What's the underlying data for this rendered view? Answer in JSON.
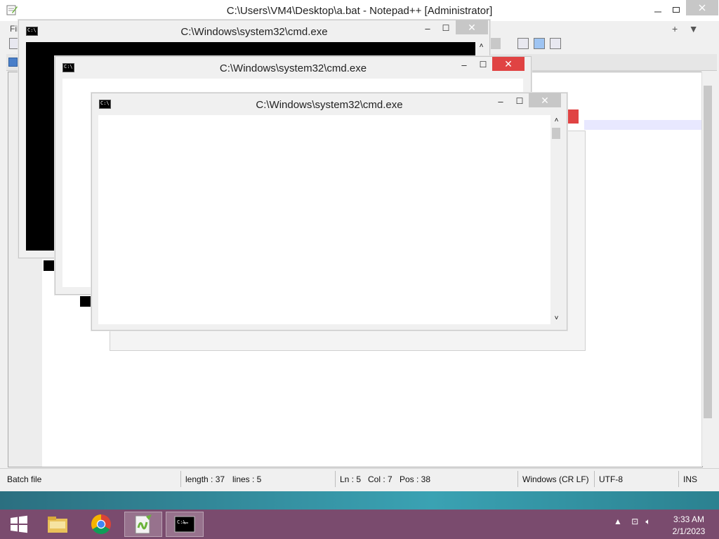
{
  "notepadpp": {
    "title": "C:\\Users\\VM4\\Desktop\\a.bat - Notepad++ [Administrator]",
    "menu_partial": "Fil",
    "statusbar": {
      "filetype": "Batch file",
      "length": "length : 37",
      "lines": "lines : 5",
      "ln": "Ln : 5",
      "col": "Col : 7",
      "pos": "Pos : 38",
      "eol": "Windows (CR LF)",
      "encoding": "UTF-8",
      "mode": "INS"
    }
  },
  "cmd_windows": [
    {
      "title": "C:\\Windows\\system32\\cmd.exe"
    },
    {
      "title": "C:\\Windows\\system32\\cmd.exe"
    },
    {
      "title": "C:\\Windows\\system32\\cmd.exe"
    }
  ],
  "taskbar": {
    "time": "3:33 AM",
    "date": "2/1/2023",
    "buttons": [
      "start",
      "file-explorer",
      "chrome",
      "notepadpp",
      "cmd"
    ]
  },
  "colors": {
    "close_red": "#e04343",
    "taskbar": "#7a4b6e",
    "desktop_strip": "#3aa2b3"
  },
  "icons": {
    "start": "windows-logo-icon",
    "explorer": "folder-icon",
    "chrome": "chrome-icon",
    "notepadpp": "notepadpp-icon",
    "cmd": "cmd-icon"
  }
}
